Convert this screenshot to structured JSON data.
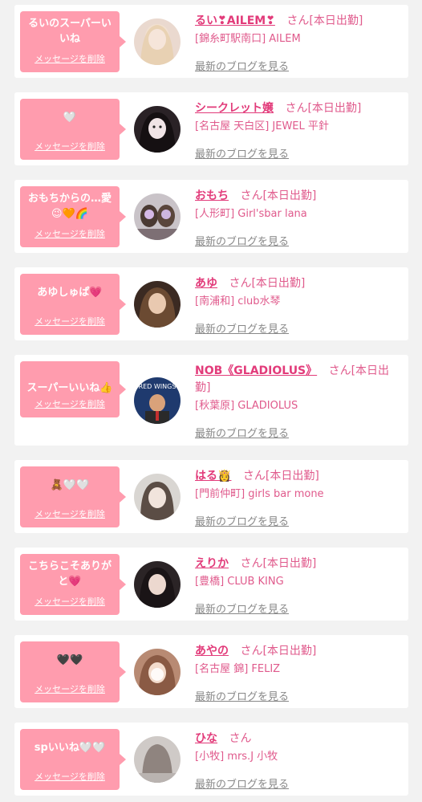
{
  "colors": {
    "bubble": "#ff9cae",
    "name": "#e23b7a",
    "text": "#e05a8c",
    "blog_link": "#888888",
    "background": "#f2f2f2"
  },
  "labels": {
    "delete": "メッセージを削除",
    "san": "さん",
    "blog": "最新のブログを見る"
  },
  "items": [
    {
      "message": "るいのスーパーいいね",
      "name": "るい❣AILEM❣",
      "status": "[本日出勤]",
      "shop": "[錦糸町駅南口] AILEM",
      "avatar": "cast-photo"
    },
    {
      "message": "🤍",
      "name": "シークレット嬢",
      "status": "[本日出勤]",
      "shop": "[名古屋 天白区] JEWEL 平針",
      "avatar": "cast-photo"
    },
    {
      "message": "おもちからの…愛😉🧡🌈",
      "name": "おもち",
      "status": "[本日出勤]",
      "shop": "[人形町] Girl'sbar lana",
      "avatar": "cast-photo"
    },
    {
      "message": "あゆしゅぱ💗",
      "name": "あゆ",
      "status": "[本日出勤]",
      "shop": "[南浦和] club水琴",
      "avatar": "cast-photo"
    },
    {
      "message": "スーパーいいね👍",
      "name": "NOB《GLADIOLUS》",
      "status": "[本日出勤]",
      "shop": "[秋葉原] GLADIOLUS",
      "avatar": "cast-photo"
    },
    {
      "message": "🧸🤍🤍",
      "name": "はる👸",
      "status": "[本日出勤]",
      "shop": "[門前仲町] girls bar mone",
      "avatar": "cast-photo"
    },
    {
      "message": "こちらこそありがと💗",
      "name": "えりか",
      "status": "[本日出勤]",
      "shop": "[豊橋] CLUB KING",
      "avatar": "cast-photo"
    },
    {
      "message": "🖤🖤",
      "name": "あやの",
      "status": "[本日出勤]",
      "shop": "[名古屋 錦] FELIZ",
      "avatar": "cast-photo"
    },
    {
      "message": "spいいね🤍🤍",
      "name": "ひな",
      "status": "",
      "shop": "[小牧] mrs.J 小牧",
      "avatar": "cast-photo"
    }
  ]
}
